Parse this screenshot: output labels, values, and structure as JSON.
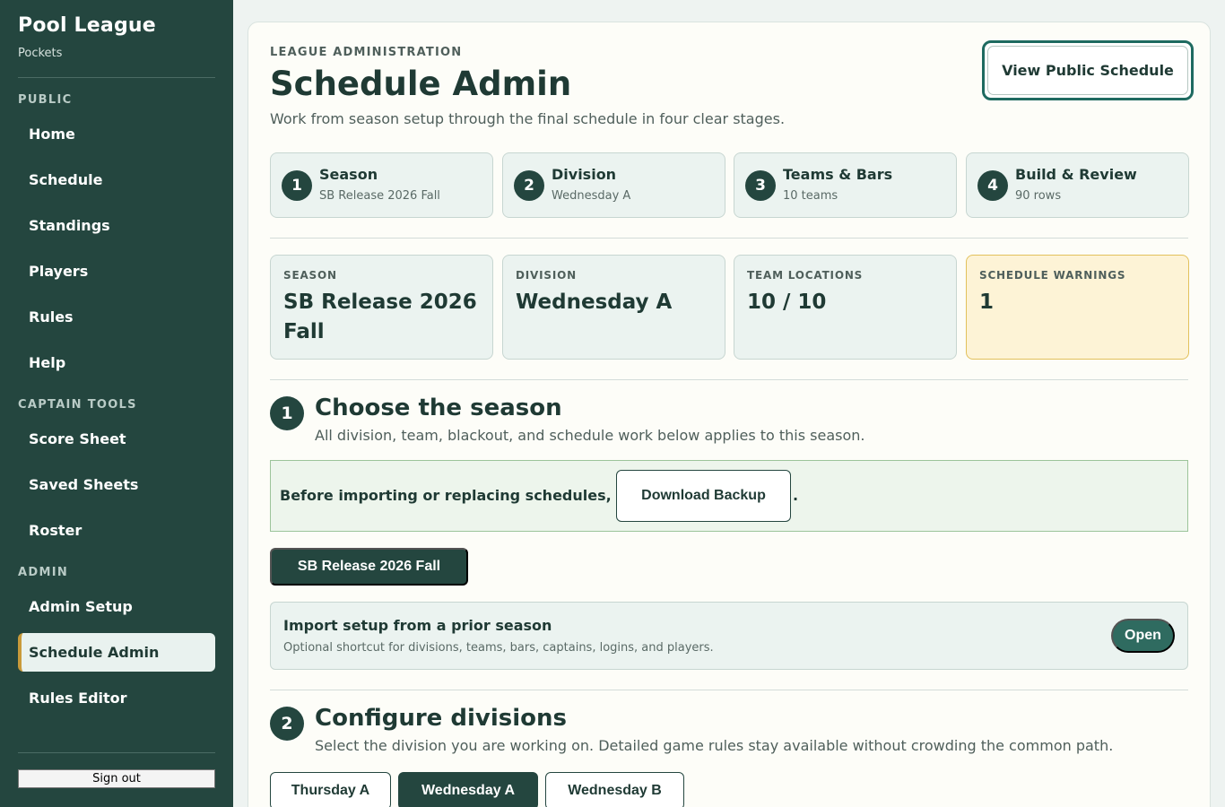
{
  "app": {
    "title": "Pool League",
    "subtitle": "Pockets"
  },
  "sidebar": {
    "sections": [
      {
        "label": "PUBLIC",
        "items": [
          "Home",
          "Schedule",
          "Standings",
          "Players",
          "Rules",
          "Help"
        ]
      },
      {
        "label": "CAPTAIN TOOLS",
        "items": [
          "Score Sheet",
          "Saved Sheets",
          "Roster"
        ]
      },
      {
        "label": "ADMIN",
        "items": [
          "Admin Setup",
          "Schedule Admin",
          "Rules Editor"
        ]
      }
    ],
    "active_item": "Schedule Admin",
    "signout_label": "Sign out"
  },
  "header": {
    "eyebrow": "LEAGUE ADMINISTRATION",
    "title": "Schedule Admin",
    "lead": "Work from season setup through the final schedule in four clear stages.",
    "public_button": "View Public Schedule"
  },
  "steps": [
    {
      "num": "1",
      "title": "Season",
      "sub": "SB Release 2026 Fall"
    },
    {
      "num": "2",
      "title": "Division",
      "sub": "Wednesday A"
    },
    {
      "num": "3",
      "title": "Teams & Bars",
      "sub": "10 teams"
    },
    {
      "num": "4",
      "title": "Build & Review",
      "sub": "90 rows"
    }
  ],
  "stats": [
    {
      "label": "SEASON",
      "value": "SB Release 2026 Fall",
      "warn": false
    },
    {
      "label": "DIVISION",
      "value": "Wednesday A",
      "warn": false
    },
    {
      "label": "TEAM LOCATIONS",
      "value": "10 / 10",
      "warn": false
    },
    {
      "label": "SCHEDULE WARNINGS",
      "value": "1",
      "warn": true
    }
  ],
  "section1": {
    "num": "1",
    "title": "Choose the season",
    "desc": "All division, team, blackout, and schedule work below applies to this season.",
    "backup_text": "Before importing or replacing schedules,",
    "backup_button": "Download Backup",
    "backup_suffix": ".",
    "season_button": "SB Release 2026 Fall",
    "import_title": "Import setup from a prior season",
    "import_desc": "Optional shortcut for divisions, teams, bars, captains, logins, and players.",
    "import_button": "Open"
  },
  "section2": {
    "num": "2",
    "title": "Configure divisions",
    "desc": "Select the division you are working on. Detailed game rules stay available without crowding the common path.",
    "divisions": [
      "Thursday A",
      "Wednesday A",
      "Wednesday B"
    ],
    "active_division": "Wednesday A"
  }
}
